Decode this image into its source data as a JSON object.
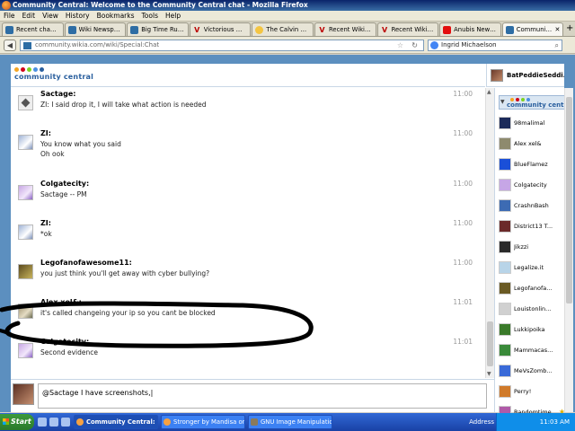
{
  "window": {
    "title": "Community Central: Welcome to the Community Central chat - Mozilla Firefox"
  },
  "menu": [
    "File",
    "Edit",
    "View",
    "History",
    "Bookmarks",
    "Tools",
    "Help"
  ],
  "tabs": [
    {
      "label": "Recent change...",
      "icon": "wikia-icon"
    },
    {
      "label": "Wiki Newspape...",
      "icon": "wikia-icon"
    },
    {
      "label": "Big Time Rush ...",
      "icon": "wikia-icon"
    },
    {
      "label": "Victorious Wiki ...",
      "icon": "victorious-icon"
    },
    {
      "label": "The Calvin and ...",
      "icon": "calvin-icon"
    },
    {
      "label": "Recent Wiki Ac...",
      "icon": "victorious-icon"
    },
    {
      "label": "Recent Wiki Ac...",
      "icon": "victorious-icon"
    },
    {
      "label": "Anubis News W...",
      "icon": "anubis-icon"
    },
    {
      "label": "Community C...",
      "icon": "wikia-icon",
      "active": true
    }
  ],
  "nav": {
    "url": "community.wikia.com/wiki/Special:Chat",
    "search_value": "Ingrid Michaelson"
  },
  "header": {
    "logo_text": "community central",
    "current_user": "BatPeddieSeddi..."
  },
  "messages": [
    {
      "user": "Sactage:",
      "text": [
        "ZI: I said drop it, I will take what action is needed"
      ],
      "time": "11:00",
      "avatar": "sactage"
    },
    {
      "user": "ZI:",
      "text": [
        "You know what you said",
        "Oh ook"
      ],
      "time": "11:00",
      "avatar": "zl"
    },
    {
      "user": "Colgatecity:",
      "text": [
        "Sactage -- PM"
      ],
      "time": "11:00",
      "avatar": "colg"
    },
    {
      "user": "ZI:",
      "text": [
        "*ok"
      ],
      "time": "11:00",
      "avatar": "zl"
    },
    {
      "user": "Legofanofawesome11:",
      "text": [
        "you just think you'll get away with cyber bullying?"
      ],
      "time": "11:00",
      "avatar": "lego"
    },
    {
      "user": "Alex xel&:",
      "text": [
        "it's called changeing your ip so you cant be blocked"
      ],
      "time": "11:01",
      "avatar": "alex"
    },
    {
      "user": "Colgatecity:",
      "text": [
        "Second evidence"
      ],
      "time": "11:01",
      "avatar": "colg"
    }
  ],
  "input": {
    "value": "@Sactage I have screenshots,"
  },
  "userlist": {
    "header": "community central",
    "users": [
      {
        "name": "98malimal",
        "color": "#1b2a5a"
      },
      {
        "name": "Alex xel&",
        "color": "#8e8a6e"
      },
      {
        "name": "BlueFlamez",
        "color": "#1a4fd8"
      },
      {
        "name": "Colgatecity",
        "color": "#c6a6e6"
      },
      {
        "name": "CrashnBash",
        "color": "#3d6bb3"
      },
      {
        "name": "District13 T...",
        "color": "#6b2a2a"
      },
      {
        "name": "Jikzzi",
        "color": "#2a2a2a"
      },
      {
        "name": "Legalize.it",
        "color": "#b8d4e8"
      },
      {
        "name": "Legofanofa...",
        "color": "#6a5a24"
      },
      {
        "name": "Louistonlin...",
        "color": "#d0d0d0"
      },
      {
        "name": "Lukkipoika",
        "color": "#3a7a2a"
      },
      {
        "name": "Mammacas...",
        "color": "#3a8a3a"
      },
      {
        "name": "MeVsZomb...",
        "color": "#3a6ad8"
      },
      {
        "name": "Perry!",
        "color": "#d07a2a"
      },
      {
        "name": "Randomtime",
        "color": "#b05aa8",
        "star": true
      }
    ]
  },
  "taskbar": {
    "start": "Start",
    "buttons": [
      {
        "label": "Community Central: ...",
        "active": true
      },
      {
        "label": "Stronger by Mandisa on V...",
        "active": false
      },
      {
        "label": "GNU Image Manipulation ...",
        "active": false,
        "gimp": true
      }
    ],
    "address_label": "Address",
    "clock": "11:03 AM"
  }
}
